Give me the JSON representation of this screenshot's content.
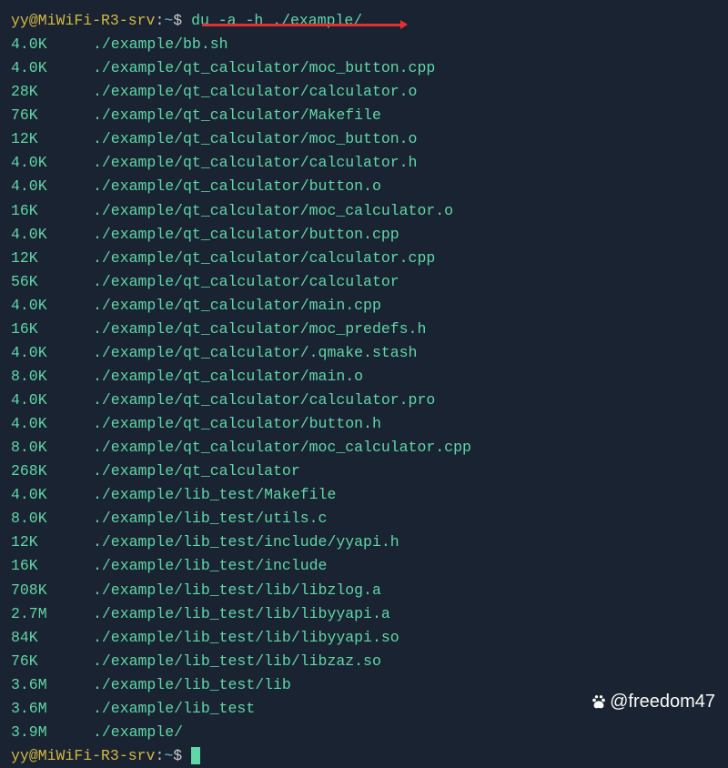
{
  "prompt": {
    "user": "yy",
    "host": "MiWiFi-R3-srv",
    "path": "~",
    "symbol": "$"
  },
  "command": "du -a -h ./example/",
  "output": [
    {
      "size": "4.0K",
      "path": "./example/bb.sh"
    },
    {
      "size": "4.0K",
      "path": "./example/qt_calculator/moc_button.cpp"
    },
    {
      "size": "28K",
      "path": "./example/qt_calculator/calculator.o"
    },
    {
      "size": "76K",
      "path": "./example/qt_calculator/Makefile"
    },
    {
      "size": "12K",
      "path": "./example/qt_calculator/moc_button.o"
    },
    {
      "size": "4.0K",
      "path": "./example/qt_calculator/calculator.h"
    },
    {
      "size": "4.0K",
      "path": "./example/qt_calculator/button.o"
    },
    {
      "size": "16K",
      "path": "./example/qt_calculator/moc_calculator.o"
    },
    {
      "size": "4.0K",
      "path": "./example/qt_calculator/button.cpp"
    },
    {
      "size": "12K",
      "path": "./example/qt_calculator/calculator.cpp"
    },
    {
      "size": "56K",
      "path": "./example/qt_calculator/calculator"
    },
    {
      "size": "4.0K",
      "path": "./example/qt_calculator/main.cpp"
    },
    {
      "size": "16K",
      "path": "./example/qt_calculator/moc_predefs.h"
    },
    {
      "size": "4.0K",
      "path": "./example/qt_calculator/.qmake.stash"
    },
    {
      "size": "8.0K",
      "path": "./example/qt_calculator/main.o"
    },
    {
      "size": "4.0K",
      "path": "./example/qt_calculator/calculator.pro"
    },
    {
      "size": "4.0K",
      "path": "./example/qt_calculator/button.h"
    },
    {
      "size": "8.0K",
      "path": "./example/qt_calculator/moc_calculator.cpp"
    },
    {
      "size": "268K",
      "path": "./example/qt_calculator"
    },
    {
      "size": "4.0K",
      "path": "./example/lib_test/Makefile"
    },
    {
      "size": "8.0K",
      "path": "./example/lib_test/utils.c"
    },
    {
      "size": "12K",
      "path": "./example/lib_test/include/yyapi.h"
    },
    {
      "size": "16K",
      "path": "./example/lib_test/include"
    },
    {
      "size": "708K",
      "path": "./example/lib_test/lib/libzlog.a"
    },
    {
      "size": "2.7M",
      "path": "./example/lib_test/lib/libyyapi.a"
    },
    {
      "size": "84K",
      "path": "./example/lib_test/lib/libyyapi.so"
    },
    {
      "size": "76K",
      "path": "./example/lib_test/lib/libzaz.so"
    },
    {
      "size": "3.6M",
      "path": "./example/lib_test/lib"
    },
    {
      "size": "3.6M",
      "path": "./example/lib_test"
    },
    {
      "size": "3.9M",
      "path": "./example/"
    }
  ],
  "watermark": "@freedom47"
}
